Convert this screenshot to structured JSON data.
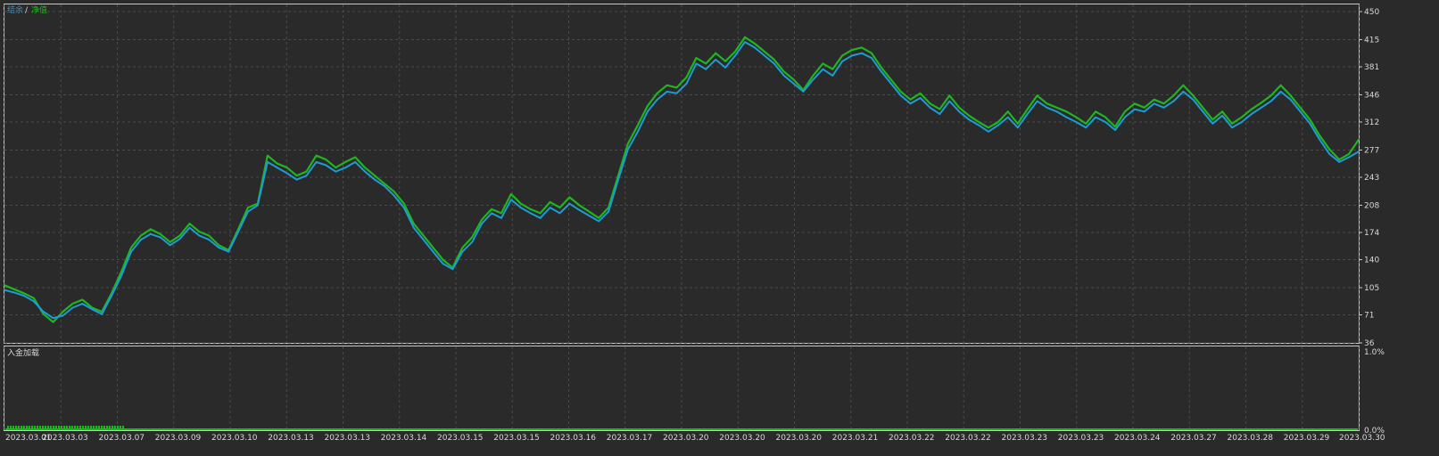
{
  "colors": {
    "background": "#2a2a2a",
    "frame": "#c8c8c8",
    "grid": "#4a4a4a",
    "balance": "#1e9bd7",
    "equity": "#1fb51f",
    "text": "#d8d8d8"
  },
  "legend": {
    "balance_label": "结余",
    "separator": "/",
    "equity_label": "净值"
  },
  "sub_panel": {
    "title": "入金加载",
    "ytick_top": "1.0%",
    "ytick_bottom": "0.0%"
  },
  "chart_data": {
    "type": "line",
    "yticks": [
      "450",
      "415",
      "381",
      "346",
      "312",
      "277",
      "243",
      "208",
      "174",
      "140",
      "105",
      "71",
      "36"
    ],
    "ylim": [
      36,
      450
    ],
    "xticks": [
      "2023.03.01",
      "2023.03.03",
      "2023.03.07",
      "2023.03.09",
      "2023.03.10",
      "2023.03.13",
      "2023.03.13",
      "2023.03.14",
      "2023.03.15",
      "2023.03.15",
      "2023.03.16",
      "2023.03.17",
      "2023.03.20",
      "2023.03.20",
      "2023.03.20",
      "2023.03.21",
      "2023.03.22",
      "2023.03.22",
      "2023.03.23",
      "2023.03.23",
      "2023.03.24",
      "2023.03.27",
      "2023.03.28",
      "2023.03.29",
      "2023.03.30"
    ],
    "grid": true,
    "legend_position": "top-left",
    "series": [
      {
        "name": "结余",
        "values": [
          102,
          99,
          95,
          88,
          75,
          67,
          70,
          80,
          85,
          78,
          72,
          95,
          120,
          150,
          165,
          172,
          168,
          158,
          166,
          180,
          170,
          165,
          155,
          150,
          175,
          200,
          208,
          262,
          255,
          248,
          240,
          245,
          262,
          258,
          250,
          255,
          262,
          250,
          240,
          232,
          220,
          205,
          180,
          165,
          150,
          135,
          128,
          150,
          162,
          185,
          198,
          192,
          215,
          205,
          198,
          192,
          205,
          198,
          210,
          202,
          195,
          188,
          200,
          240,
          278,
          300,
          325,
          340,
          350,
          348,
          360,
          385,
          378,
          390,
          380,
          395,
          412,
          405,
          395,
          385,
          370,
          360,
          350,
          365,
          378,
          370,
          388,
          395,
          398,
          392,
          375,
          360,
          345,
          335,
          342,
          330,
          322,
          338,
          325,
          315,
          308,
          300,
          308,
          318,
          305,
          322,
          338,
          330,
          325,
          318,
          312,
          305,
          318,
          312,
          302,
          318,
          328,
          325,
          335,
          330,
          338,
          350,
          340,
          325,
          310,
          320,
          305,
          312,
          322,
          330,
          338,
          350,
          340,
          325,
          310,
          290,
          272,
          262,
          268,
          275
        ]
      },
      {
        "name": "净值",
        "values": [
          108,
          103,
          98,
          92,
          72,
          62,
          75,
          85,
          90,
          80,
          75,
          98,
          125,
          155,
          170,
          178,
          172,
          162,
          170,
          185,
          175,
          170,
          158,
          152,
          178,
          205,
          210,
          270,
          260,
          255,
          245,
          250,
          270,
          265,
          255,
          262,
          268,
          255,
          245,
          235,
          225,
          210,
          185,
          170,
          155,
          140,
          130,
          155,
          168,
          190,
          203,
          198,
          222,
          210,
          203,
          198,
          212,
          205,
          218,
          208,
          200,
          192,
          205,
          245,
          285,
          308,
          332,
          348,
          358,
          355,
          368,
          392,
          385,
          398,
          388,
          400,
          418,
          410,
          400,
          390,
          375,
          365,
          352,
          370,
          385,
          378,
          395,
          402,
          405,
          398,
          380,
          365,
          350,
          340,
          348,
          335,
          328,
          345,
          330,
          320,
          312,
          305,
          312,
          325,
          310,
          328,
          345,
          335,
          330,
          325,
          318,
          310,
          325,
          318,
          306,
          325,
          335,
          330,
          340,
          335,
          345,
          358,
          345,
          330,
          315,
          325,
          310,
          318,
          328,
          336,
          345,
          358,
          345,
          330,
          315,
          295,
          278,
          265,
          272,
          290
        ]
      }
    ]
  }
}
